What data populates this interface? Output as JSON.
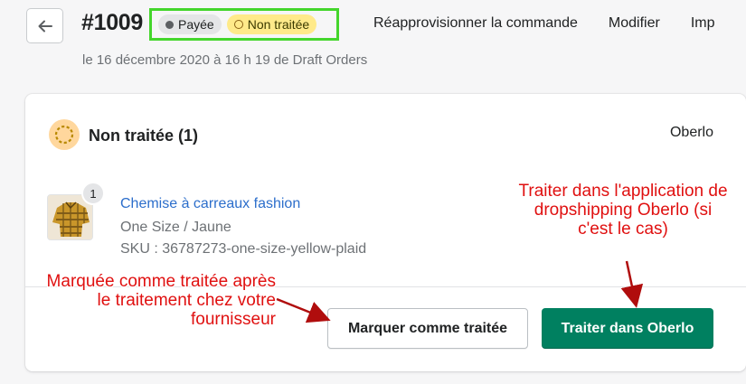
{
  "header": {
    "order_number": "#1009",
    "badges": {
      "paid": "Payée",
      "unfulfilled": "Non traitée"
    },
    "actions": [
      "Réapprovisionner la commande",
      "Modifier",
      "Imp"
    ],
    "subtitle": "le 16 décembre 2020 à 16 h 19 de Draft Orders"
  },
  "card": {
    "title": "Non traitée (1)",
    "app_name": "Oberlo",
    "line_item": {
      "quantity": "1",
      "name": "Chemise à carreaux fashion",
      "variant": "One Size / Jaune",
      "sku": "SKU : 36787273-one-size-yellow-plaid"
    },
    "buttons": {
      "mark_fulfilled": "Marquer comme traitée",
      "fulfill_app": "Traiter dans Oberlo"
    }
  },
  "annotations": {
    "oberlo_note": [
      "Traiter dans l'application de",
      "dropshipping Oberlo (si",
      "c'est le cas)"
    ],
    "manual_note": [
      "Marquée comme traitée après",
      "le traitement chez votre",
      "fournisseur"
    ]
  },
  "colors": {
    "primary_button": "#008060",
    "link": "#2c6ecb",
    "highlight_frame": "#44d62c",
    "annotation": "#e01010",
    "unfulfilled_badge": "#ffea8a"
  },
  "icons": {
    "back": "arrow-left-icon",
    "status": "unfulfilled-ring-icon",
    "thumbnail": "plaid-shirt-thumbnail"
  }
}
